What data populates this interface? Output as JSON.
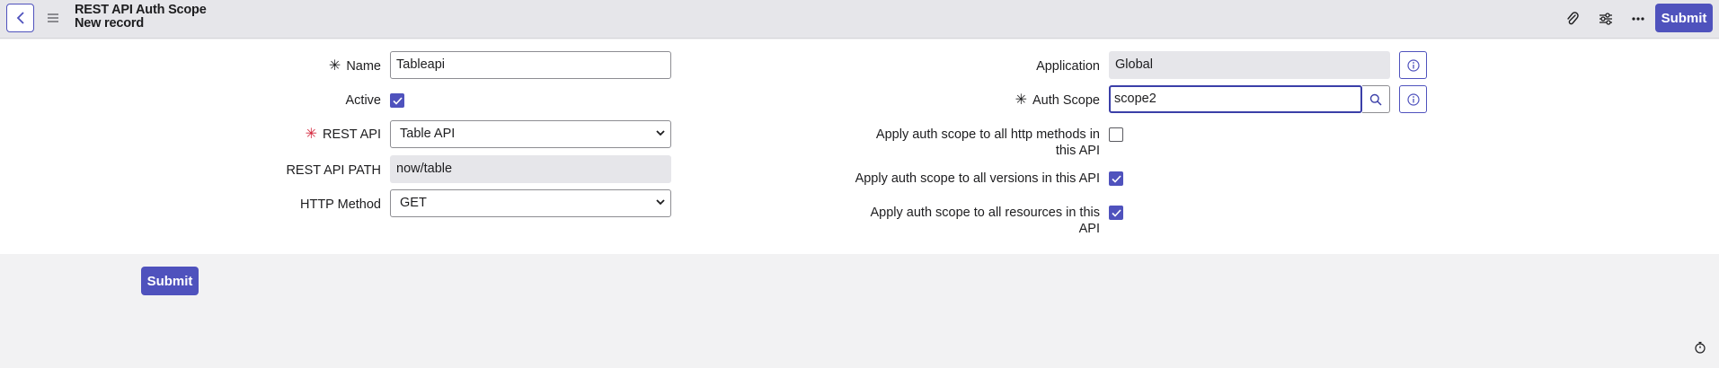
{
  "header": {
    "title": "REST API Auth Scope",
    "subtitle": "New record",
    "submit_label": "Submit",
    "icons": [
      "back-icon",
      "menu-icon",
      "paperclip-icon",
      "settings-sliders-icon",
      "more-icon"
    ]
  },
  "form": {
    "name": {
      "label": "Name",
      "value": "Tableapi",
      "required": true
    },
    "active": {
      "label": "Active",
      "checked": true
    },
    "rest_api": {
      "label": "REST API",
      "value": "Table API",
      "required": true
    },
    "rest_api_path": {
      "label": "REST API PATH",
      "value": "now/table"
    },
    "http_method": {
      "label": "HTTP Method",
      "value": "GET"
    },
    "application": {
      "label": "Application",
      "value": "Global"
    },
    "auth_scope": {
      "label": "Auth Scope",
      "value": "scope2",
      "required": true
    },
    "apply_http_methods": {
      "label_line1": "Apply auth scope to all http methods in",
      "label_line2": "this API",
      "checked": false
    },
    "apply_versions": {
      "label": "Apply auth scope to all versions in this API",
      "checked": true
    },
    "apply_resources": {
      "label_line1": "Apply auth scope to all resources in this",
      "label_line2": "API",
      "checked": true
    }
  },
  "footer": {
    "submit_label": "Submit"
  },
  "colors": {
    "accent": "#4f52bd",
    "required_red": "#d4283d",
    "header_bg": "#e6e6ea"
  }
}
